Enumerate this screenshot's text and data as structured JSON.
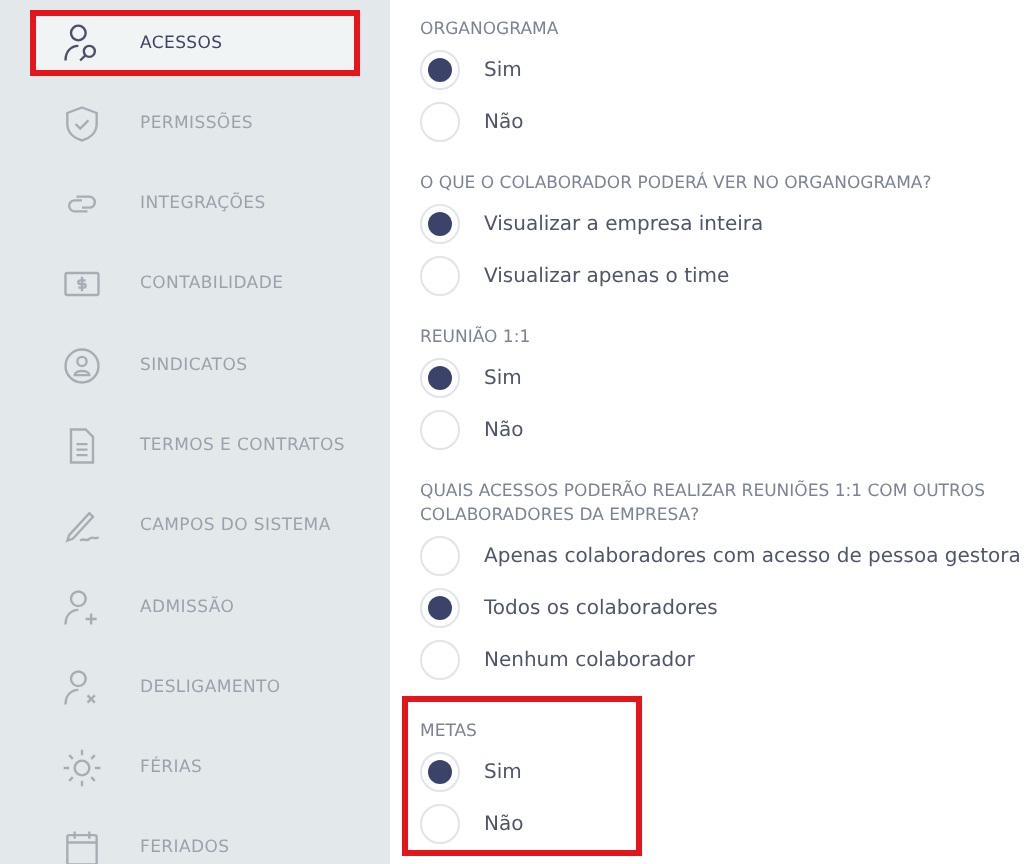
{
  "sidebar": {
    "items": [
      {
        "label": "ACESSOS",
        "selected": true,
        "highlighted": true
      },
      {
        "label": "PERMISSÕES",
        "selected": false,
        "highlighted": false
      },
      {
        "label": "INTEGRAÇÕES",
        "selected": false,
        "highlighted": false
      },
      {
        "label": "CONTABILIDADE",
        "selected": false,
        "highlighted": false
      },
      {
        "label": "SINDICATOS",
        "selected": false,
        "highlighted": false
      },
      {
        "label": "TERMOS E CONTRATOS",
        "selected": false,
        "highlighted": false
      },
      {
        "label": "CAMPOS DO SISTEMA",
        "selected": false,
        "highlighted": false
      },
      {
        "label": "ADMISSÃO",
        "selected": false,
        "highlighted": false
      },
      {
        "label": "DESLIGAMENTO",
        "selected": false,
        "highlighted": false
      },
      {
        "label": "FÉRIAS",
        "selected": false,
        "highlighted": false
      },
      {
        "label": "FERIADOS",
        "selected": false,
        "highlighted": false
      }
    ]
  },
  "sections": [
    {
      "label": "ORGANOGRAMA",
      "highlighted": false,
      "options": [
        {
          "label": "Sim",
          "selected": true
        },
        {
          "label": "Não",
          "selected": false
        }
      ]
    },
    {
      "label": "O QUE O COLABORADOR PODERÁ VER NO ORGANOGRAMA?",
      "highlighted": false,
      "options": [
        {
          "label": "Visualizar a empresa inteira",
          "selected": true
        },
        {
          "label": "Visualizar apenas o time",
          "selected": false
        }
      ]
    },
    {
      "label": "REUNIÃO 1:1",
      "highlighted": false,
      "options": [
        {
          "label": "Sim",
          "selected": true
        },
        {
          "label": "Não",
          "selected": false
        }
      ]
    },
    {
      "label": "QUAIS ACESSOS PODERÃO REALIZAR REUNIÕES 1:1 COM OUTROS COLABORADORES DA EMPRESA?",
      "highlighted": false,
      "options": [
        {
          "label": "Apenas colaboradores com acesso de pessoa gestora",
          "selected": false
        },
        {
          "label": "Todos os colaboradores",
          "selected": true
        },
        {
          "label": "Nenhum colaborador",
          "selected": false
        }
      ]
    },
    {
      "label": "METAS",
      "highlighted": true,
      "options": [
        {
          "label": "Sim",
          "selected": true
        },
        {
          "label": "Não",
          "selected": false
        }
      ]
    }
  ]
}
